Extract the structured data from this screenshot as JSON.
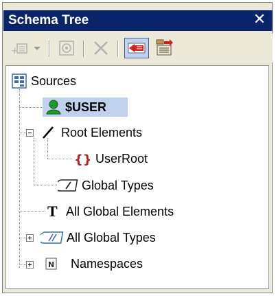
{
  "window": {
    "title": "Schema Tree",
    "close_glyph": "✕"
  },
  "toolbar": {
    "buttons": [
      {
        "icon": "add-element-icon",
        "enabled": false
      },
      {
        "icon": "dropdown-arrow-icon",
        "enabled": false
      },
      {
        "icon": "properties-icon",
        "enabled": false
      },
      {
        "icon": "delete-icon",
        "enabled": false
      },
      {
        "icon": "sync-selection-icon",
        "enabled": true,
        "active": true
      },
      {
        "icon": "schema-tree-options-icon",
        "enabled": true
      }
    ]
  },
  "tree": {
    "root": {
      "label": "Sources",
      "icon": "sources-icon"
    },
    "nodes": [
      {
        "label": "$USER",
        "icon": "user-icon",
        "selected": true,
        "bold": true
      },
      {
        "label": "Root Elements",
        "icon": "root-elements-icon",
        "expanded": true
      },
      {
        "label": "UserRoot",
        "icon": "element-braces-icon",
        "color": "#b22222"
      },
      {
        "label": "Global Types",
        "icon": "global-types-icon"
      },
      {
        "label": "All Global Elements",
        "icon": "text-t-icon"
      },
      {
        "label": "All Global Types",
        "icon": "all-global-types-icon",
        "expanded": false
      },
      {
        "label": "Namespaces",
        "icon": "namespace-icon",
        "expanded": false
      }
    ]
  }
}
